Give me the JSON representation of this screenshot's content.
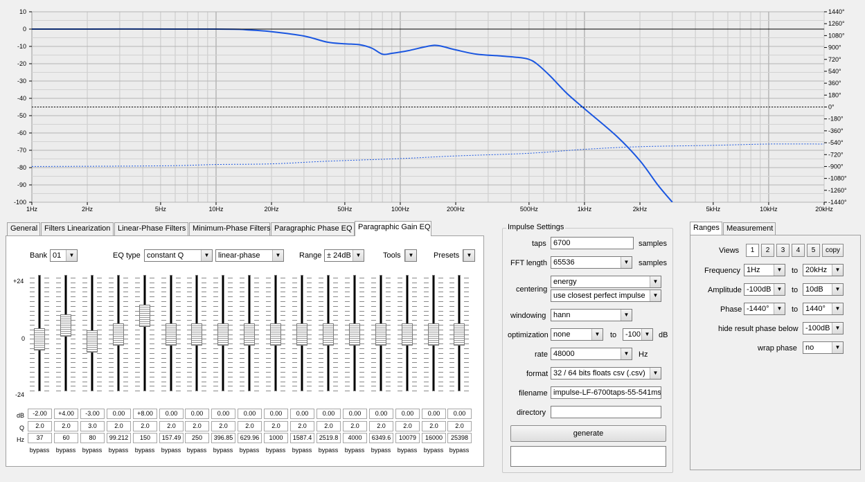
{
  "graph": {
    "y_left_ticks": [
      "10",
      "0",
      "-10",
      "-20",
      "-30",
      "-40",
      "-50",
      "-60",
      "-70",
      "-80",
      "-90",
      "-100"
    ],
    "y_right_ticks": [
      "1440°",
      "1260°",
      "1080°",
      "900°",
      "720°",
      "540°",
      "360°",
      "180°",
      "0°",
      "-180°",
      "-360°",
      "-540°",
      "-720°",
      "-900°",
      "-1080°",
      "-1260°",
      "-1440°"
    ],
    "x_ticks": [
      {
        "f": 1,
        "label": "1Hz"
      },
      {
        "f": 2,
        "label": "2Hz"
      },
      {
        "f": 5,
        "label": "5Hz"
      },
      {
        "f": 10,
        "label": "10Hz"
      },
      {
        "f": 20,
        "label": "20Hz"
      },
      {
        "f": 50,
        "label": "50Hz"
      },
      {
        "f": 100,
        "label": "100Hz"
      },
      {
        "f": 200,
        "label": "200Hz"
      },
      {
        "f": 500,
        "label": "500Hz"
      },
      {
        "f": 1000,
        "label": "1kHz"
      },
      {
        "f": 2000,
        "label": "2kHz"
      },
      {
        "f": 5000,
        "label": "5kHz"
      },
      {
        "f": 10000,
        "label": "10kHz"
      },
      {
        "f": 20000,
        "label": "20kHz"
      }
    ]
  },
  "chart_data": {
    "type": "line",
    "xlim": [
      1,
      20000
    ],
    "ylim": [
      -100,
      10
    ],
    "y2lim": [
      -1440,
      1440
    ],
    "x_scale": "log",
    "grid": true,
    "series": [
      {
        "axis": "left",
        "style": "solid",
        "color": "#1a56e0",
        "points": [
          [
            1,
            0
          ],
          [
            10,
            0
          ],
          [
            15,
            -0.5
          ],
          [
            20,
            -1.5
          ],
          [
            30,
            -4
          ],
          [
            40,
            -7.5
          ],
          [
            50,
            -8.5
          ],
          [
            60,
            -9
          ],
          [
            70,
            -11
          ],
          [
            80,
            -14.5
          ],
          [
            90,
            -14
          ],
          [
            110,
            -12.5
          ],
          [
            140,
            -10
          ],
          [
            160,
            -9.5
          ],
          [
            200,
            -12
          ],
          [
            260,
            -14.5
          ],
          [
            350,
            -15.5
          ],
          [
            450,
            -16.5
          ],
          [
            500,
            -17.5
          ],
          [
            550,
            -20
          ],
          [
            650,
            -27
          ],
          [
            800,
            -37
          ],
          [
            1000,
            -46
          ],
          [
            1500,
            -62
          ],
          [
            2000,
            -76
          ],
          [
            2500,
            -90
          ],
          [
            3000,
            -100
          ]
        ]
      },
      {
        "axis": "right",
        "style": "dotted",
        "color": "#1a56e0",
        "points": [
          [
            1,
            -900
          ],
          [
            5,
            -890
          ],
          [
            10,
            -870
          ],
          [
            20,
            -860
          ],
          [
            40,
            -820
          ],
          [
            100,
            -780
          ],
          [
            200,
            -740
          ],
          [
            500,
            -700
          ],
          [
            1000,
            -640
          ],
          [
            2000,
            -600
          ],
          [
            5000,
            -580
          ],
          [
            10000,
            -560
          ],
          [
            20000,
            -560
          ]
        ]
      },
      {
        "axis": "left",
        "style": "solid",
        "color": "#000000",
        "points": [
          [
            1,
            0
          ],
          [
            20000,
            0
          ]
        ]
      },
      {
        "axis": "left",
        "style": "dotted",
        "color": "#000000",
        "points": [
          [
            1,
            -45
          ],
          [
            20000,
            -45
          ]
        ]
      }
    ]
  },
  "tabs": [
    "General",
    "Filters Linearization",
    "Linear-Phase Filters",
    "Minimum-Phase Filters",
    "Paragraphic Phase EQ",
    "Paragraphic Gain EQ"
  ],
  "eq": {
    "bank_label": "Bank",
    "bank_value": "01",
    "eqtype_label": "EQ type",
    "eqtype_value": "constant Q",
    "phase_value": "linear-phase",
    "range_label": "Range",
    "range_value": "± 24dB",
    "tools_label": "Tools",
    "presets_label": "Presets",
    "scale_top": "+24",
    "scale_mid": "0",
    "scale_bot": "-24",
    "row_db": "dB",
    "row_q": "Q",
    "row_hz": "Hz",
    "bands": [
      {
        "db": "-2.00",
        "q": "2.0",
        "hz": "37",
        "bypass": "bypass",
        "gain": -2
      },
      {
        "db": "+4.00",
        "q": "2.0",
        "hz": "60",
        "bypass": "bypass",
        "gain": 4
      },
      {
        "db": "-3.00",
        "q": "3.0",
        "hz": "80",
        "bypass": "bypass",
        "gain": -3
      },
      {
        "db": "0.00",
        "q": "2.0",
        "hz": "99.212",
        "bypass": "bypass",
        "gain": 0
      },
      {
        "db": "+8.00",
        "q": "2.0",
        "hz": "150",
        "bypass": "bypass",
        "gain": 8
      },
      {
        "db": "0.00",
        "q": "2.0",
        "hz": "157.49",
        "bypass": "bypass",
        "gain": 0
      },
      {
        "db": "0.00",
        "q": "2.0",
        "hz": "250",
        "bypass": "bypass",
        "gain": 0
      },
      {
        "db": "0.00",
        "q": "2.0",
        "hz": "396.85",
        "bypass": "bypass",
        "gain": 0
      },
      {
        "db": "0.00",
        "q": "2.0",
        "hz": "629.96",
        "bypass": "bypass",
        "gain": 0
      },
      {
        "db": "0.00",
        "q": "2.0",
        "hz": "1000",
        "bypass": "bypass",
        "gain": 0
      },
      {
        "db": "0.00",
        "q": "2.0",
        "hz": "1587.4",
        "bypass": "bypass",
        "gain": 0
      },
      {
        "db": "0.00",
        "q": "2.0",
        "hz": "2519.8",
        "bypass": "bypass",
        "gain": 0
      },
      {
        "db": "0.00",
        "q": "2.0",
        "hz": "4000",
        "bypass": "bypass",
        "gain": 0
      },
      {
        "db": "0.00",
        "q": "2.0",
        "hz": "6349.6",
        "bypass": "bypass",
        "gain": 0
      },
      {
        "db": "0.00",
        "q": "2.0",
        "hz": "10079",
        "bypass": "bypass",
        "gain": 0
      },
      {
        "db": "0.00",
        "q": "2.0",
        "hz": "16000",
        "bypass": "bypass",
        "gain": 0
      },
      {
        "db": "0.00",
        "q": "2.0",
        "hz": "25398",
        "bypass": "bypass",
        "gain": 0
      }
    ]
  },
  "impulse": {
    "title": "Impulse Settings",
    "taps_label": "taps",
    "taps_value": "6700",
    "taps_unit": "samples",
    "fft_label": "FFT length",
    "fft_value": "65536",
    "fft_unit": "samples",
    "centering_label": "centering",
    "centering_value": "energy",
    "centering_value2": "use closest perfect impulse",
    "windowing_label": "windowing",
    "windowing_value": "hann",
    "optimization_label": "optimization",
    "optimization_value": "none",
    "to_label": "to",
    "opt_db_value": "-100",
    "opt_db_unit": "dB",
    "rate_label": "rate",
    "rate_value": "48000",
    "rate_unit": "Hz",
    "format_label": "format",
    "format_value": "32 / 64 bits floats csv (.csv)",
    "filename_label": "filename",
    "filename_value": "impulse-LF-6700taps-55-541ms",
    "directory_label": "directory",
    "directory_value": "",
    "generate_label": "generate"
  },
  "ranges": {
    "tabs": [
      "Ranges",
      "Measurement"
    ],
    "views_label": "Views",
    "views": [
      "1",
      "2",
      "3",
      "4",
      "5"
    ],
    "copy_label": "copy",
    "frequency_label": "Frequency",
    "freq_from": "1Hz",
    "freq_to": "20kHz",
    "amplitude_label": "Amplitude",
    "amp_from": "-100dB",
    "amp_to": "10dB",
    "phase_label": "Phase",
    "phase_from": "-1440°",
    "phase_to": "1440°",
    "hide_label": "hide result phase below",
    "hide_value": "-100dB",
    "wrap_label": "wrap phase",
    "wrap_value": "no",
    "to_label": "to"
  }
}
